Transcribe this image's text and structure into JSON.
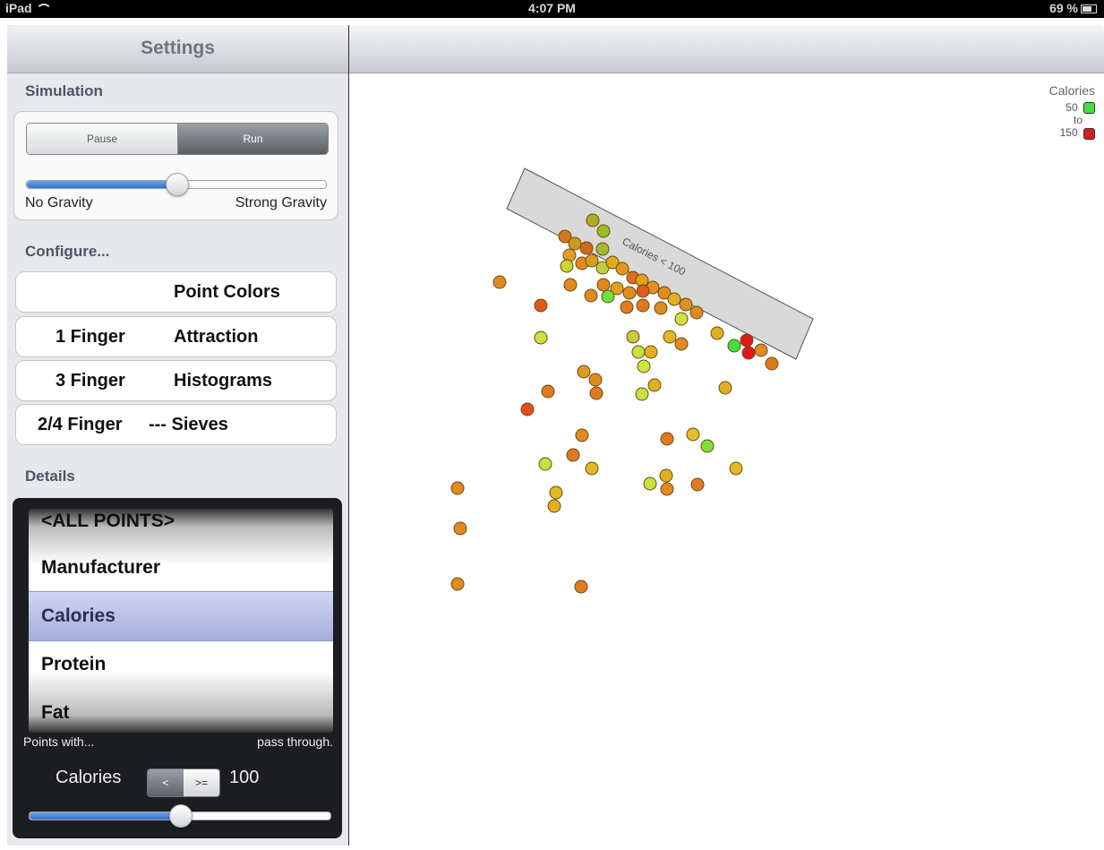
{
  "status": {
    "device": "iPad",
    "time": "4:07 PM",
    "battery": "69 %"
  },
  "settings": {
    "title": "Settings",
    "simulation_header": "Simulation",
    "pause_label": "Pause",
    "run_label": "Run",
    "gravity_level": 0.5,
    "no_gravity_label": "No Gravity",
    "strong_gravity_label": "Strong Gravity",
    "configure_header": "Configure...",
    "configure_rows": [
      {
        "left": "",
        "right": "Point Colors"
      },
      {
        "left": "1 Finger",
        "right": "Attraction"
      },
      {
        "left": "3 Finger",
        "right": "Histograms"
      },
      {
        "left": "2/4 Finger",
        "right": "--- Sieves"
      }
    ],
    "details_header": "Details",
    "picker_items": [
      "<ALL POINTS>",
      "Manufacturer",
      "Calories",
      "Protein",
      "Fat"
    ],
    "picker_selected": "Calories",
    "points_with_label": "Points with...",
    "pass_through_label": "pass through.",
    "field_label": "Calories",
    "op_less": "<",
    "op_gte": ">=",
    "threshold_value": "100",
    "threshold_level": 0.5
  },
  "legend": {
    "title": "Calories",
    "min_label": "50",
    "to_label": "to",
    "max_label": "150",
    "min_color": "#44e044",
    "max_color": "#d42020"
  },
  "sieve": {
    "label": "Calories  < 100",
    "fill": "#d9d9d9"
  },
  "chart_data": {
    "type": "scatter",
    "title": "",
    "legend": "Calories 50 to 150",
    "points": [
      [
        662,
        246
      ],
      [
        674,
        258
      ],
      [
        631,
        264
      ],
      [
        642,
        272
      ],
      [
        655,
        277
      ],
      [
        673,
        278
      ],
      [
        636,
        285
      ],
      [
        650,
        294
      ],
      [
        633,
        297
      ],
      [
        661,
        291
      ],
      [
        673,
        299
      ],
      [
        684,
        293
      ],
      [
        695,
        300
      ],
      [
        707,
        310
      ],
      [
        717,
        313
      ],
      [
        729,
        321
      ],
      [
        742,
        327
      ],
      [
        753,
        334
      ],
      [
        766,
        340
      ],
      [
        778,
        349
      ],
      [
        718,
        325
      ],
      [
        703,
        327
      ],
      [
        689,
        322
      ],
      [
        674,
        318
      ],
      [
        660,
        330
      ],
      [
        679,
        331
      ],
      [
        700,
        343
      ],
      [
        718,
        341
      ],
      [
        738,
        344
      ],
      [
        761,
        356
      ],
      [
        558,
        315
      ],
      [
        637,
        318
      ],
      [
        604,
        341
      ],
      [
        604,
        377
      ],
      [
        707,
        376
      ],
      [
        713,
        393
      ],
      [
        727,
        393
      ],
      [
        748,
        376
      ],
      [
        761,
        384
      ],
      [
        801,
        372
      ],
      [
        820,
        386
      ],
      [
        834,
        380
      ],
      [
        836,
        394
      ],
      [
        850,
        391
      ],
      [
        862,
        406
      ],
      [
        719,
        409
      ],
      [
        652,
        415
      ],
      [
        665,
        424
      ],
      [
        666,
        439
      ],
      [
        612,
        437
      ],
      [
        589,
        457
      ],
      [
        717,
        440
      ],
      [
        731,
        430
      ],
      [
        810,
        433
      ],
      [
        650,
        486
      ],
      [
        745,
        490
      ],
      [
        774,
        485
      ],
      [
        790,
        498
      ],
      [
        640,
        508
      ],
      [
        609,
        518
      ],
      [
        661,
        523
      ],
      [
        822,
        523
      ],
      [
        726,
        540
      ],
      [
        744,
        531
      ],
      [
        745,
        546
      ],
      [
        779,
        541
      ],
      [
        511,
        545
      ],
      [
        621,
        550
      ],
      [
        619,
        565
      ],
      [
        514,
        590
      ],
      [
        511,
        652
      ],
      [
        649,
        655
      ]
    ],
    "colors": [
      "#a8b020",
      "#9cbc20",
      "#d07a20",
      "#d09a20",
      "#d06a20",
      "#a0bc30",
      "#e0a020",
      "#e08a20",
      "#c8d830",
      "#d8a020",
      "#c0d040",
      "#e0aa20",
      "#e09a20",
      "#e06a20",
      "#e0a020",
      "#e09020",
      "#e08a20",
      "#e0b020",
      "#e09020",
      "#e08a20",
      "#e05a18",
      "#e08a20",
      "#e0a020",
      "#e08a20",
      "#e08a20",
      "#70e040",
      "#e07a20",
      "#e07a20",
      "#e08a20",
      "#d0e040",
      "#e08a20",
      "#e08a20",
      "#e05a18",
      "#d0e040",
      "#d0c840",
      "#c8e040",
      "#e0b020",
      "#e0b828",
      "#e08a20",
      "#e0b020",
      "#40e040",
      "#e01a18",
      "#e01a18",
      "#e08a20",
      "#e07a20",
      "#c8e840",
      "#e09a20",
      "#e08a20",
      "#e07a20",
      "#e07a20",
      "#e05018",
      "#c8e040",
      "#e0b020",
      "#e0b020",
      "#e08a20",
      "#e07a20",
      "#e0c028",
      "#80e040",
      "#e07a20",
      "#c8e040",
      "#e0b828",
      "#e0b828",
      "#c8e040",
      "#e0b020",
      "#e08a20",
      "#e07a20",
      "#e08a20",
      "#e0b828",
      "#e0b020",
      "#e08a20",
      "#e08a20",
      "#e07a20"
    ]
  }
}
